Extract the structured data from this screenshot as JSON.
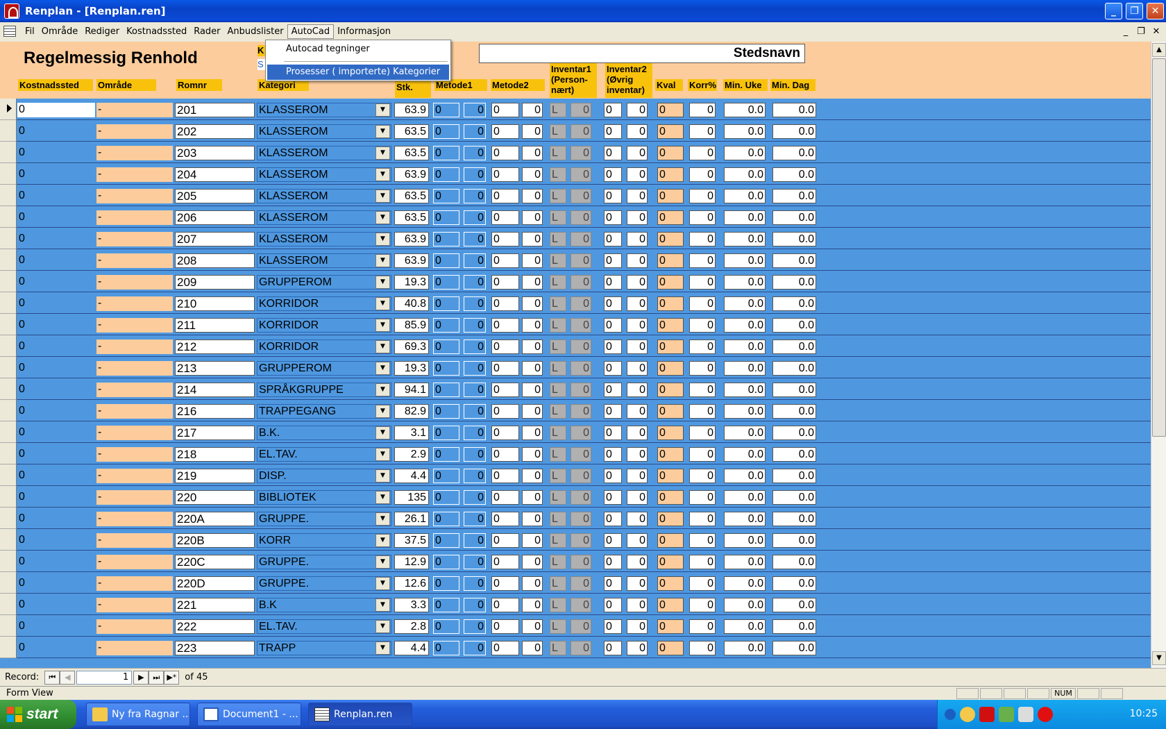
{
  "window": {
    "title": "Renplan - [Renplan.ren]"
  },
  "menu": [
    "Fil",
    "Område",
    "Rediger",
    "Kostnadssted",
    "Rader",
    "Anbudslister",
    "AutoCad",
    "Informasjon"
  ],
  "autocad_menu": [
    "Autocad tegninger",
    "Prosesser ( importerte) Kategorier"
  ],
  "form": {
    "title": "Regelmessig Renhold",
    "stedsnavn": "Stedsnavn",
    "frag_k": "K",
    "frag_s": "S"
  },
  "columns": {
    "kostnadssted": "Kostnadssted",
    "omrade": "Område",
    "romnr": "Romnr",
    "kategori": "Kategori",
    "stk": "Stk.",
    "metode1": "Metode1",
    "metode2": "Metode2",
    "inventar1": "Inventar1 (Person-nært)",
    "inventar2": "Inventar2 (Øvrig inventar)",
    "kval": "Kval",
    "korr": "Korr%",
    "min_uke": "Min. Uke",
    "min_dag": "Min. Dag"
  },
  "row_defaults": {
    "kostnadssted": "0",
    "omrade": "-",
    "metode1_code": "0",
    "metode1_val": "0",
    "metode2_code": "0",
    "metode2_val": "0",
    "inventar1_code": "L",
    "inventar1_val": "0",
    "inventar2_code": "0",
    "inventar2_val": "0",
    "kval": "0",
    "korr": "0",
    "min_uke": "0.0",
    "min_dag": "0.0"
  },
  "rows": [
    {
      "romnr": "201",
      "kategori": "KLASSEROM",
      "stk": "63.9"
    },
    {
      "romnr": "202",
      "kategori": "KLASSEROM",
      "stk": "63.5"
    },
    {
      "romnr": "203",
      "kategori": "KLASSEROM",
      "stk": "63.5"
    },
    {
      "romnr": "204",
      "kategori": "KLASSEROM",
      "stk": "63.9"
    },
    {
      "romnr": "205",
      "kategori": "KLASSEROM",
      "stk": "63.5"
    },
    {
      "romnr": "206",
      "kategori": "KLASSEROM",
      "stk": "63.5"
    },
    {
      "romnr": "207",
      "kategori": "KLASSEROM",
      "stk": "63.9"
    },
    {
      "romnr": "208",
      "kategori": "KLASSEROM",
      "stk": "63.9"
    },
    {
      "romnr": "209",
      "kategori": "GRUPPEROM",
      "stk": "19.3"
    },
    {
      "romnr": "210",
      "kategori": "KORRIDOR",
      "stk": "40.8"
    },
    {
      "romnr": "211",
      "kategori": "KORRIDOR",
      "stk": "85.9"
    },
    {
      "romnr": "212",
      "kategori": "KORRIDOR",
      "stk": "69.3"
    },
    {
      "romnr": "213",
      "kategori": "GRUPPEROM",
      "stk": "19.3"
    },
    {
      "romnr": "214",
      "kategori": "SPRÅKGRUPPE",
      "stk": "94.1"
    },
    {
      "romnr": "216",
      "kategori": "TRAPPEGANG",
      "stk": "82.9"
    },
    {
      "romnr": "217",
      "kategori": "B.K.",
      "stk": "3.1"
    },
    {
      "romnr": "218",
      "kategori": "EL.TAV.",
      "stk": "2.9"
    },
    {
      "romnr": "219",
      "kategori": "DISP.",
      "stk": "4.4"
    },
    {
      "romnr": "220",
      "kategori": "BIBLIOTEK",
      "stk": "135"
    },
    {
      "romnr": "220A",
      "kategori": "GRUPPE.",
      "stk": "26.1"
    },
    {
      "romnr": "220B",
      "kategori": "KORR",
      "stk": "37.5"
    },
    {
      "romnr": "220C",
      "kategori": "GRUPPE.",
      "stk": "12.9"
    },
    {
      "romnr": "220D",
      "kategori": "GRUPPE.",
      "stk": "12.6"
    },
    {
      "romnr": "221",
      "kategori": "B.K",
      "stk": "3.3"
    },
    {
      "romnr": "222",
      "kategori": "EL.TAV.",
      "stk": "2.8"
    },
    {
      "romnr": "223",
      "kategori": "TRAPP",
      "stk": "4.4"
    }
  ],
  "nav": {
    "record_label": "Record:",
    "current": "1",
    "of_total": "of 45"
  },
  "status": {
    "text": "Form View",
    "num": "NUM"
  },
  "taskbar": {
    "start": "start",
    "items": [
      "Ny fra Ragnar ...",
      "Document1 - ...",
      "Renplan.ren"
    ],
    "clock": "10:25"
  }
}
